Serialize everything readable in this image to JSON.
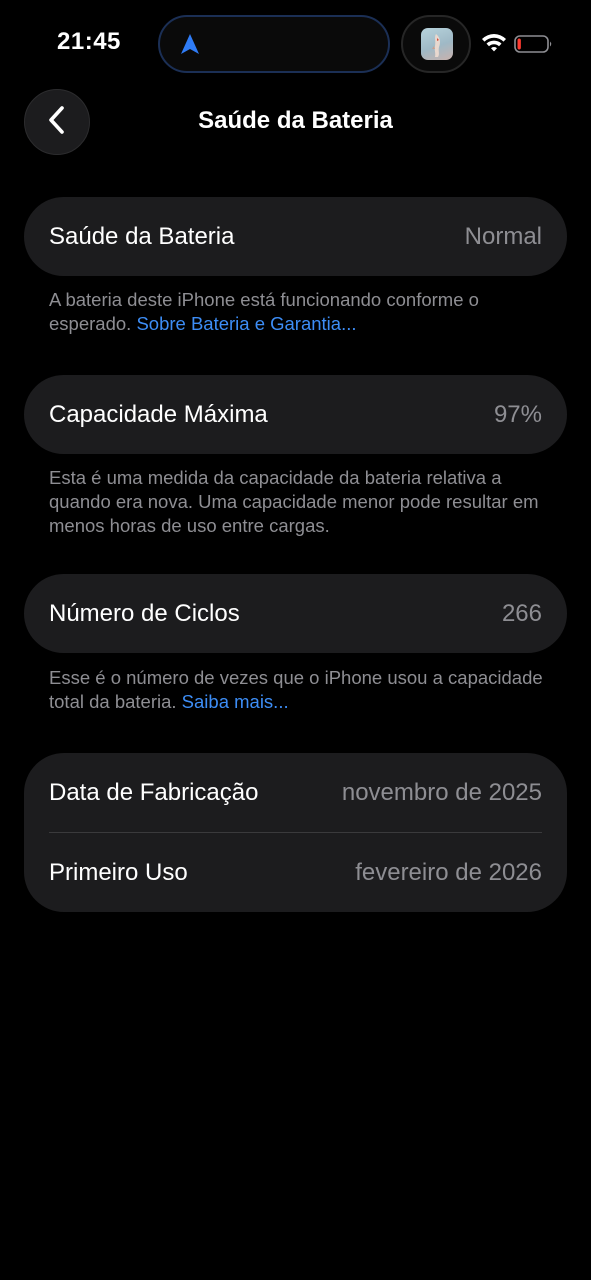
{
  "status_bar": {
    "time": "21:45",
    "icons": [
      "location-arrow-icon",
      "app-thumbnail-icon",
      "wifi-icon",
      "battery-icon"
    ],
    "battery_level": 0.12,
    "battery_color": "#ff3b30",
    "location_color": "#2f7cf6"
  },
  "nav": {
    "title": "Saúde da Bateria",
    "back_icon": "chevron-left-icon"
  },
  "battery_health": {
    "label": "Saúde da Bateria",
    "value": "Normal",
    "footnote": "A bateria deste iPhone está funcionando conforme o esperado.",
    "link": "Sobre Bateria e Garantia..."
  },
  "max_capacity": {
    "label": "Capacidade Máxima",
    "value": "97%",
    "footnote": "Esta é uma medida da capacidade da bateria relativa a quando era nova. Uma capacidade menor pode resultar em menos horas de uso entre cargas."
  },
  "cycle_count": {
    "label": "Número de Ciclos",
    "value": "266",
    "footnote": "Esse é o número de vezes que o iPhone usou a capacidade total da bateria.",
    "link": "Saiba mais..."
  },
  "dates": {
    "manufacture_label": "Data de Fabricação",
    "manufacture_value": "novembro de 2025",
    "first_use_label": "Primeiro Uso",
    "first_use_value": "fevereiro de 2026"
  },
  "colors": {
    "background": "#000000",
    "group_background": "#1c1c1e",
    "link": "#3d8df5",
    "secondary_text": "#8e8e93"
  }
}
